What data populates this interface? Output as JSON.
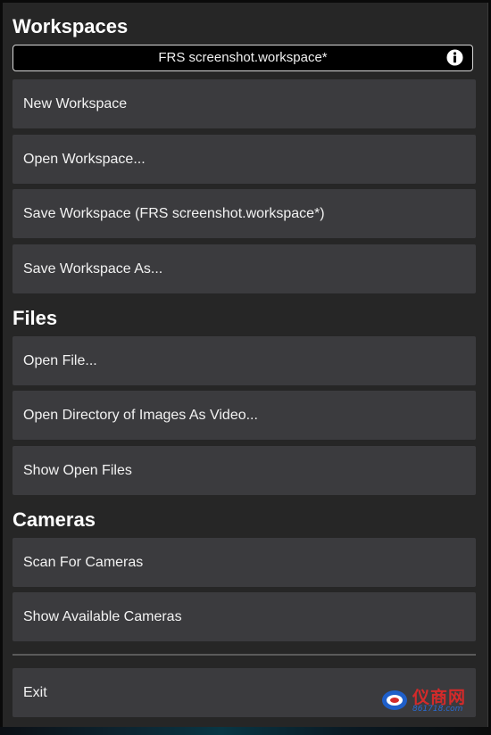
{
  "workspaces": {
    "heading": "Workspaces",
    "current_file": "FRS screenshot.workspace*",
    "info_icon": "info-icon",
    "buttons": [
      "New Workspace",
      "Open Workspace...",
      "Save Workspace (FRS screenshot.workspace*)",
      "Save Workspace As..."
    ]
  },
  "files": {
    "heading": "Files",
    "buttons": [
      "Open File...",
      "Open Directory of Images As Video...",
      "Show Open Files"
    ]
  },
  "cameras": {
    "heading": "Cameras",
    "buttons": [
      "Scan For Cameras",
      "Show Available Cameras"
    ]
  },
  "exit": {
    "label": "Exit"
  },
  "watermark": {
    "brand": "仪商网",
    "site": "861718.com"
  },
  "colors": {
    "panel_bg": "#262626",
    "button_bg": "#3b3b3e",
    "text": "#f2f2f2",
    "field_bg": "#000000",
    "field_border": "#d8d8d8"
  }
}
